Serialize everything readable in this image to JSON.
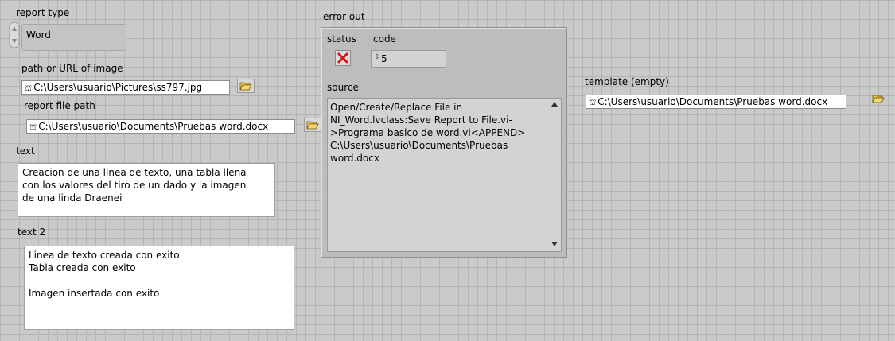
{
  "report_type": {
    "label": "report type",
    "value": "Word"
  },
  "image_path": {
    "label": "path or URL of image",
    "value": "C:\\Users\\usuario\\Pictures\\ss797.jpg",
    "path_icon": "path-icon",
    "browse_icon": "folder-open-icon"
  },
  "report_file_path": {
    "label": "report file path",
    "value": "C:\\Users\\usuario\\Documents\\Pruebas word.docx",
    "path_icon": "path-icon",
    "browse_icon": "folder-open-icon"
  },
  "text": {
    "label": "text",
    "value": "Creacion de una linea de texto, una tabla llena\ncon los valores del tiro de un dado y la imagen\nde una linda Draenei"
  },
  "text2": {
    "label": "text 2",
    "value": "Linea de texto creada con exito\nTabla creada con exito\n\nImagen insertada con exito"
  },
  "error_out": {
    "label": "error out",
    "status_label": "status",
    "status_icon": "error-x-icon",
    "code_label": "code",
    "code_value": "5",
    "code_icon": "i32-indicator-icon",
    "source_label": "source",
    "source_value": "Open/Create/Replace File in\nNI_Word.lvclass:Save Report to File.vi-\n>Programa basico de word.vi<APPEND>\nC:\\Users\\usuario\\Documents\\Pruebas\nword.docx"
  },
  "template": {
    "label": "template (empty)",
    "value": "C:\\Users\\usuario\\Documents\\Pruebas word.docx",
    "path_icon": "path-icon",
    "browse_icon": "folder-open-icon"
  },
  "colors": {
    "grid_bg": "#cacaca",
    "error_red": "#d41414"
  }
}
